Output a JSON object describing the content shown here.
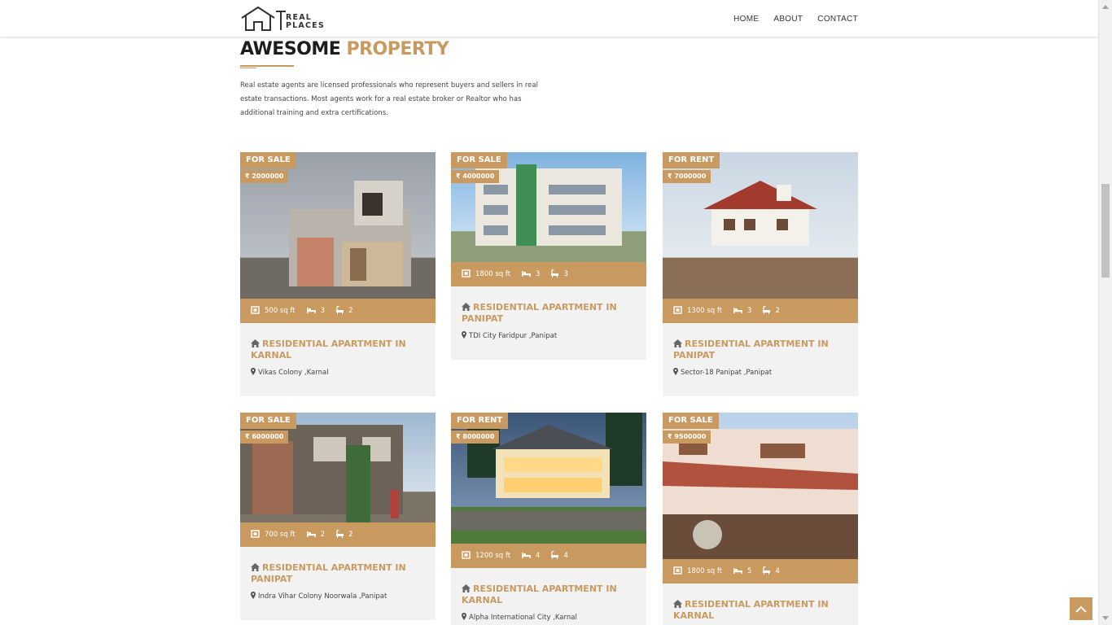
{
  "header": {
    "logo_line1": "REAL",
    "logo_line2": "PLACES",
    "nav": [
      "HOME",
      "ABOUT",
      "CONTACT"
    ]
  },
  "section": {
    "title_main": "AWESOME",
    "title_accent": "PROPERTY",
    "description": "Real estate agents are licensed professionals who represent buyers and sellers in real estate transactions. Most agents work for a real estate broker or Realtor who has additional training and extra certifications."
  },
  "colors": {
    "accent": "#c99a60",
    "card_bg": "#f2f2f2",
    "text": "#333333"
  },
  "icons": [
    "area-icon",
    "bed-icon",
    "bath-icon",
    "home-icon",
    "map-pin-icon",
    "chevron-up-icon"
  ],
  "properties": [
    {
      "status": "FOR SALE",
      "price": "₹ 2000000",
      "area": "500 sq ft",
      "beds": "3",
      "baths": "2",
      "title": "RESIDENTIAL APARTMENT IN KARNAL",
      "location": "Vikas Colony ,Karnal"
    },
    {
      "status": "FOR SALE",
      "price": "₹ 4000000",
      "area": "1800 sq ft",
      "beds": "3",
      "baths": "3",
      "title": "RESIDENTIAL APARTMENT IN PANIPAT",
      "location": "TDI City Faridpur ,Panipat"
    },
    {
      "status": "FOR RENT",
      "price": "₹ 7000000",
      "area": "1300 sq ft",
      "beds": "3",
      "baths": "2",
      "title": "RESIDENTIAL APARTMENT IN PANIPAT",
      "location": "Sector-18 Panipat ,Panipat"
    },
    {
      "status": "FOR SALE",
      "price": "₹ 6000000",
      "area": "700 sq ft",
      "beds": "2",
      "baths": "2",
      "title": "RESIDENTIAL APARTMENT IN PANIPAT",
      "location": "Indra Vihar Colony Noorwala ,Panipat"
    },
    {
      "status": "FOR RENT",
      "price": "₹ 8000000",
      "area": "1200 sq ft",
      "beds": "4",
      "baths": "4",
      "title": "RESIDENTIAL APARTMENT IN KARNAL",
      "location": "Alpha International City ,Karnal"
    },
    {
      "status": "FOR SALE",
      "price": "₹ 9500000",
      "area": "1800 sq ft",
      "beds": "5",
      "baths": "4",
      "title": "RESIDENTIAL APARTMENT IN KARNAL",
      "location": ""
    }
  ]
}
